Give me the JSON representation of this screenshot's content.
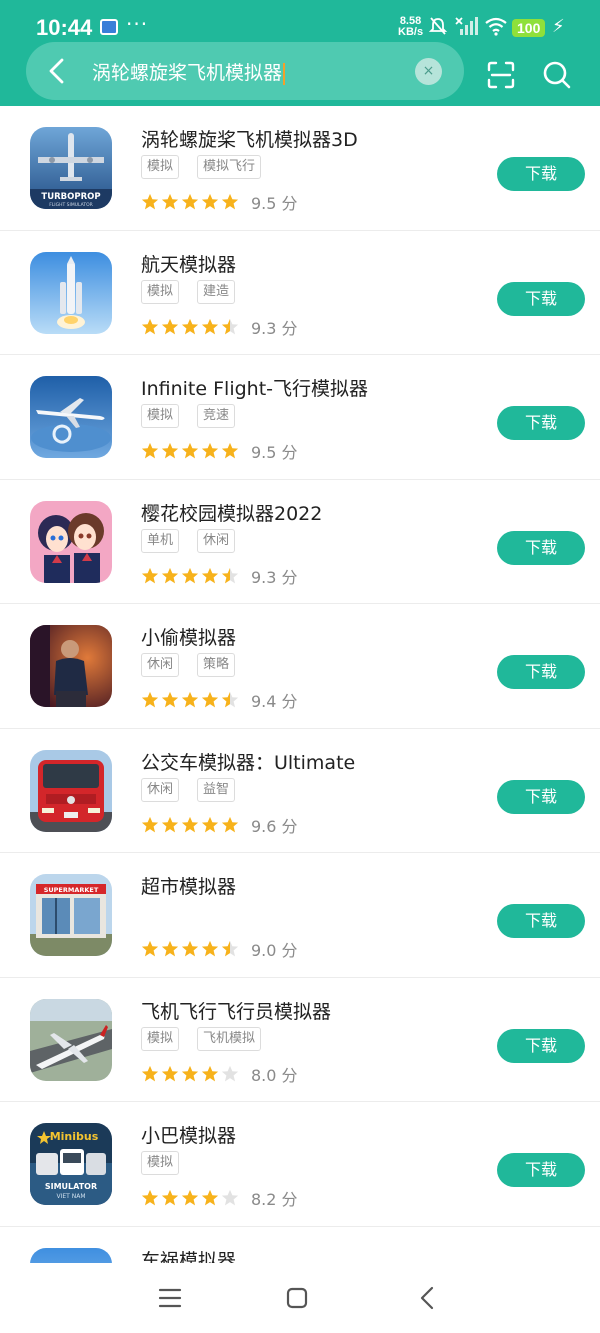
{
  "status": {
    "time": "10:44",
    "dots": "···",
    "speed_value": "8.58",
    "speed_unit": "KB/s",
    "battery": "100"
  },
  "search": {
    "query": "涡轮螺旋桨飞机模拟器",
    "clear_label": "×"
  },
  "colors": {
    "accent": "#20b89a",
    "star_on": "#f7b21b",
    "star_off": "#e2e2e2"
  },
  "apps": [
    {
      "name": "涡轮螺旋桨飞机模拟器3D",
      "tags": [
        "模拟",
        "模拟飞行"
      ],
      "stars": 5,
      "score": "9.5 分",
      "button": "下载",
      "icon": "turboprop-icon"
    },
    {
      "name": "航天模拟器",
      "tags": [
        "模拟",
        "建造"
      ],
      "stars": 4.5,
      "score": "9.3 分",
      "button": "下载",
      "icon": "rocket-icon"
    },
    {
      "name": "Infinite Flight-飞行模拟器",
      "tags": [
        "模拟",
        "竞速"
      ],
      "stars": 5,
      "score": "9.5 分",
      "button": "下载",
      "icon": "airliner-icon"
    },
    {
      "name": "樱花校园模拟器2022",
      "tags": [
        "单机",
        "休闲"
      ],
      "stars": 4.5,
      "score": "9.3 分",
      "button": "下载",
      "icon": "anime-icon"
    },
    {
      "name": "小偷模拟器",
      "tags": [
        "休闲",
        "策略"
      ],
      "stars": 4.5,
      "score": "9.4 分",
      "button": "下载",
      "icon": "thief-icon"
    },
    {
      "name": "公交车模拟器：Ultimate",
      "tags": [
        "休闲",
        "益智"
      ],
      "stars": 5,
      "score": "9.6 分",
      "button": "下载",
      "icon": "bus-icon"
    },
    {
      "name": "超市模拟器",
      "tags": [],
      "stars": 4.5,
      "score": "9.0 分",
      "button": "下载",
      "icon": "supermarket-icon"
    },
    {
      "name": "飞机飞行飞行员模拟器",
      "tags": [
        "模拟",
        "飞机模拟"
      ],
      "stars": 4,
      "score": "8.0 分",
      "button": "下载",
      "icon": "plane-icon"
    },
    {
      "name": "小巴模拟器",
      "tags": [
        "模拟"
      ],
      "stars": 4,
      "score": "8.2 分",
      "button": "下载",
      "icon": "minibus-icon"
    }
  ],
  "partial_app": {
    "name": "车祸模拟器"
  },
  "icon_text": {
    "turboprop": "TURBOPROP",
    "turboprop_sub": "FLIGHT SIMULATOR",
    "supermarket": "SUPERMARKET",
    "minibus_top": "Minibus",
    "minibus_mid": "SIMULATOR",
    "minibus_bot": "VIET NAM"
  }
}
